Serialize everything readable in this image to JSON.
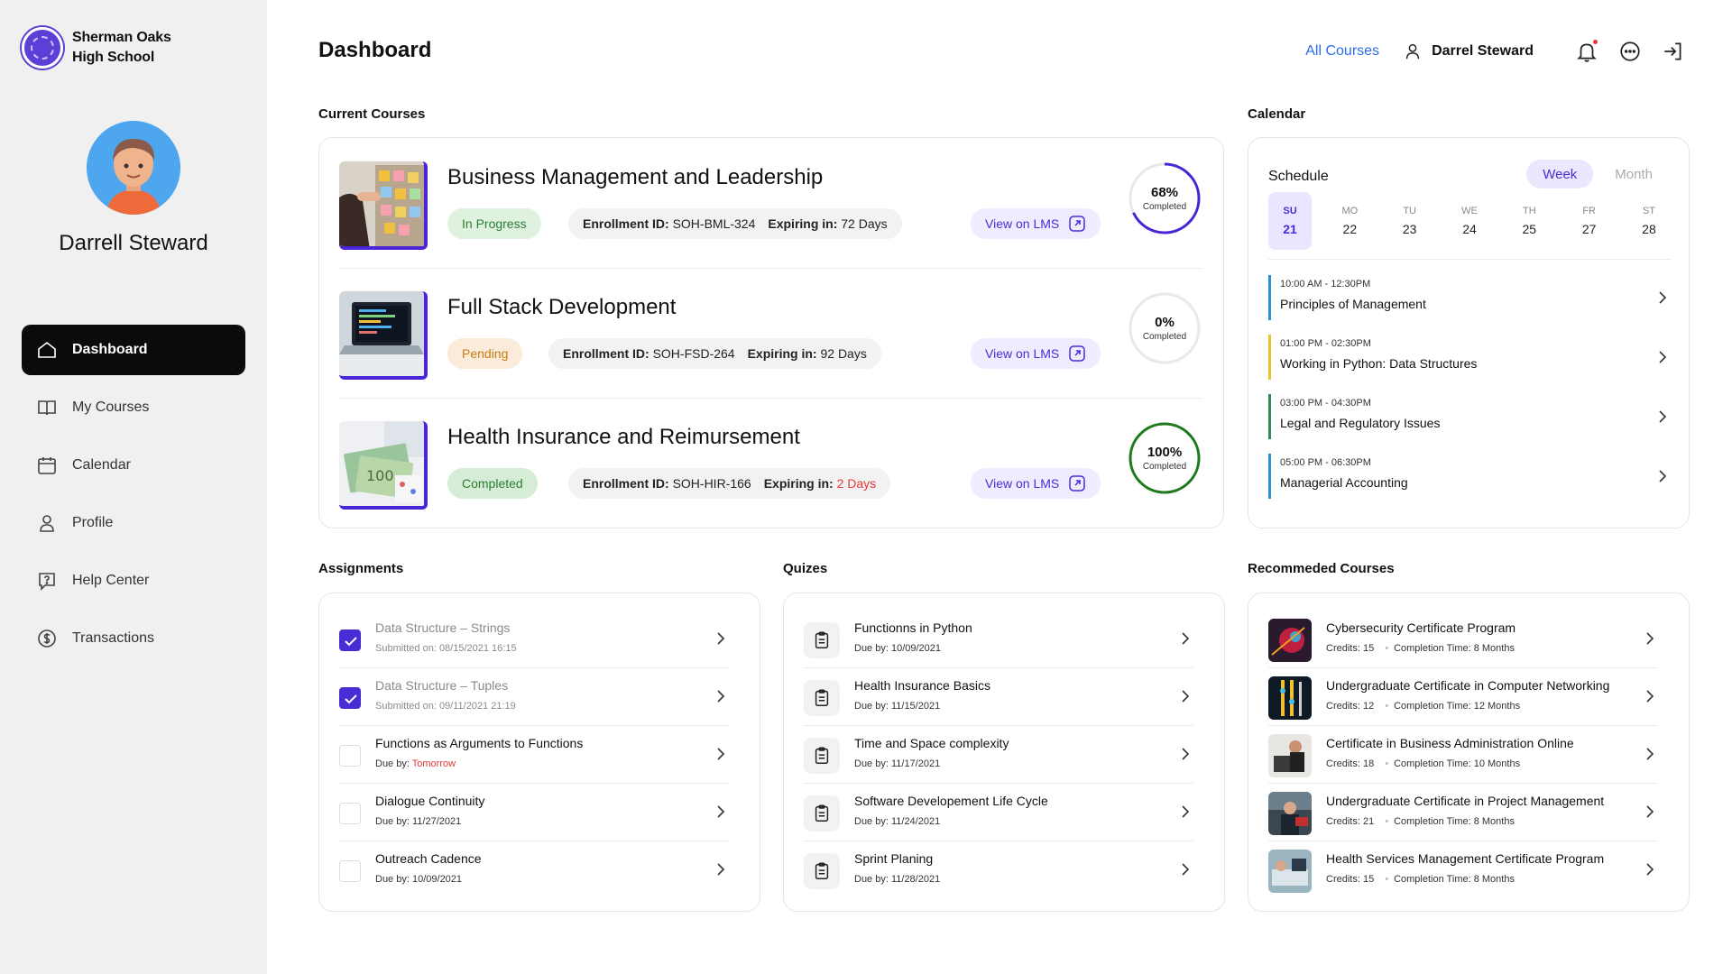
{
  "school": {
    "name": "Sherman Oaks High School"
  },
  "user": {
    "name": "Darrell Steward",
    "top_name": "Darrel Steward"
  },
  "nav": [
    {
      "label": "Dashboard",
      "icon": "home-icon",
      "active": true
    },
    {
      "label": "My Courses",
      "icon": "book-icon"
    },
    {
      "label": "Calendar",
      "icon": "calendar-icon"
    },
    {
      "label": "Profile",
      "icon": "user-icon"
    },
    {
      "label": "Help Center",
      "icon": "help-icon"
    },
    {
      "label": "Transactions",
      "icon": "dollar-icon"
    }
  ],
  "header": {
    "title": "Dashboard",
    "all_courses": "All Courses"
  },
  "sections": {
    "current_courses": "Current Courses",
    "calendar": "Calendar",
    "assignments": "Assignments",
    "quizes": "Quizes",
    "recommended": "Recommeded Courses"
  },
  "courses": [
    {
      "title": "Business Management and Leadership",
      "status": "In Progress",
      "enrollment_label": "Enrollment ID:",
      "enrollment_id": "SOH-BML-324",
      "expiring_label": "Expiring in:",
      "expiring": "72 Days",
      "lms": "View on LMS",
      "percent": "68%",
      "percent_value": 68,
      "completed": "Completed",
      "ring_color": "#4a25d6"
    },
    {
      "title": "Full Stack Development",
      "status": "Pending",
      "enrollment_label": "Enrollment ID:",
      "enrollment_id": "SOH-FSD-264",
      "expiring_label": "Expiring in:",
      "expiring": "92 Days",
      "lms": "View on LMS",
      "percent": "0%",
      "percent_value": 0,
      "completed": "Completed",
      "ring_color": "#4a25d6"
    },
    {
      "title": "Health Insurance and Reimursement",
      "status": "Completed",
      "enrollment_label": "Enrollment ID:",
      "enrollment_id": "SOH-HIR-166",
      "expiring_label": "Expiring in:",
      "expiring": "2 Days",
      "lms": "View on LMS",
      "percent": "100%",
      "percent_value": 100,
      "completed": "Completed",
      "ring_color": "#1f7a1f"
    }
  ],
  "calendar": {
    "schedule": "Schedule",
    "week": "Week",
    "month": "Month",
    "days": [
      {
        "dow": "SU",
        "date": "21",
        "selected": true
      },
      {
        "dow": "MO",
        "date": "22"
      },
      {
        "dow": "TU",
        "date": "23"
      },
      {
        "dow": "WE",
        "date": "24"
      },
      {
        "dow": "TH",
        "date": "25"
      },
      {
        "dow": "FR",
        "date": "27"
      },
      {
        "dow": "ST",
        "date": "28"
      }
    ],
    "events": [
      {
        "time": "10:00 AM - 12:30PM",
        "name": "Principles of Management",
        "color": "#2b8fd6"
      },
      {
        "time": "01:00 PM - 02:30PM",
        "name": "Working in Python: Data Structures",
        "color": "#e8c32a"
      },
      {
        "time": "03:00 PM - 04:30PM",
        "name": "Legal and Regulatory Issues",
        "color": "#2e8b57"
      },
      {
        "time": "05:00 PM - 06:30PM",
        "name": "Managerial Accounting",
        "color": "#2b8fd6"
      }
    ]
  },
  "assignments": [
    {
      "title": "Data Structure – Strings",
      "sub_label": "Submitted on:",
      "sub_value": "08/15/2021 16:15",
      "done": true
    },
    {
      "title": "Data Structure – Tuples",
      "sub_label": "Submitted on:",
      "sub_value": "09/11/2021 21:19",
      "done": true
    },
    {
      "title": "Functions as Arguments to Functions",
      "sub_label": "Due by:",
      "sub_value": "Tomorrow",
      "done": false,
      "urgent": true
    },
    {
      "title": "Dialogue Continuity",
      "sub_label": "Due by:",
      "sub_value": "11/27/2021",
      "done": false
    },
    {
      "title": "Outreach Cadence",
      "sub_label": "Due by:",
      "sub_value": "10/09/2021",
      "done": false
    }
  ],
  "quizes": [
    {
      "title": "Functionns in Python",
      "sub": "Due by: 10/09/2021"
    },
    {
      "title": "Health Insurance Basics",
      "sub": "Due by: 11/15/2021"
    },
    {
      "title": "Time and Space complexity",
      "sub": "Due by: 11/17/2021"
    },
    {
      "title": "Software Developement Life Cycle",
      "sub": "Due by: 11/24/2021"
    },
    {
      "title": "Sprint Planing",
      "sub": "Due by: 11/28/2021"
    }
  ],
  "recommended": [
    {
      "title": "Cybersecurity Certificate Program",
      "credits": "Credits: 15",
      "time": "Completion Time: 8 Months"
    },
    {
      "title": "Undergraduate Certificate in Computer Networking",
      "credits": "Credits: 12",
      "time": "Completion Time: 12 Months"
    },
    {
      "title": "Certificate in Business Administration Online",
      "credits": "Credits: 18",
      "time": "Completion Time: 10 Months"
    },
    {
      "title": "Undergraduate Certificate in Project Management",
      "credits": "Credits: 21",
      "time": "Completion Time: 8 Months"
    },
    {
      "title": "Health Services Management Certificate Program",
      "credits": "Credits: 15",
      "time": "Completion Time: 8 Months"
    }
  ]
}
